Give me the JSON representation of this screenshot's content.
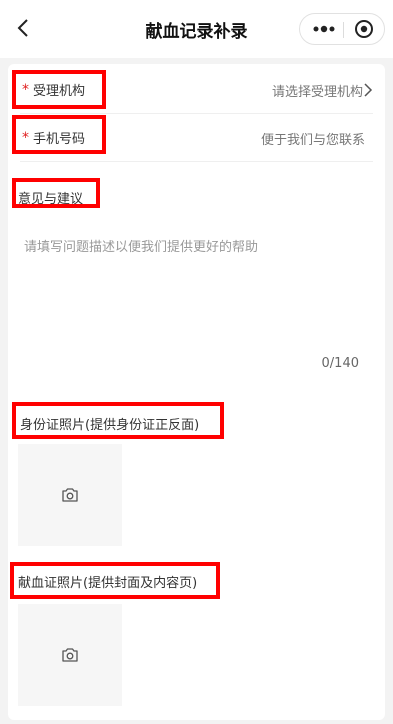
{
  "header": {
    "title": "献血记录补录",
    "back_icon": "chevron-left-icon",
    "more_icon": "more-dots-icon",
    "close_icon": "target-circle-icon"
  },
  "form": {
    "required_mark": "*",
    "institution": {
      "label": "受理机构",
      "placeholder": "请选择受理机构"
    },
    "phone": {
      "label": "手机号码",
      "placeholder": "便于我们与您联系"
    },
    "feedback": {
      "label": "意见与建议",
      "placeholder": "请填写问题描述以便我们提供更好的帮助",
      "counter": "0/140"
    },
    "id_photo": {
      "label": "身份证照片(提供身份证正反面)"
    },
    "donation_photo": {
      "label": "献血证照片(提供封面及内容页)"
    }
  },
  "colors": {
    "required": "#e02020",
    "highlight": "#ff0000",
    "background": "#f3f3f3"
  }
}
